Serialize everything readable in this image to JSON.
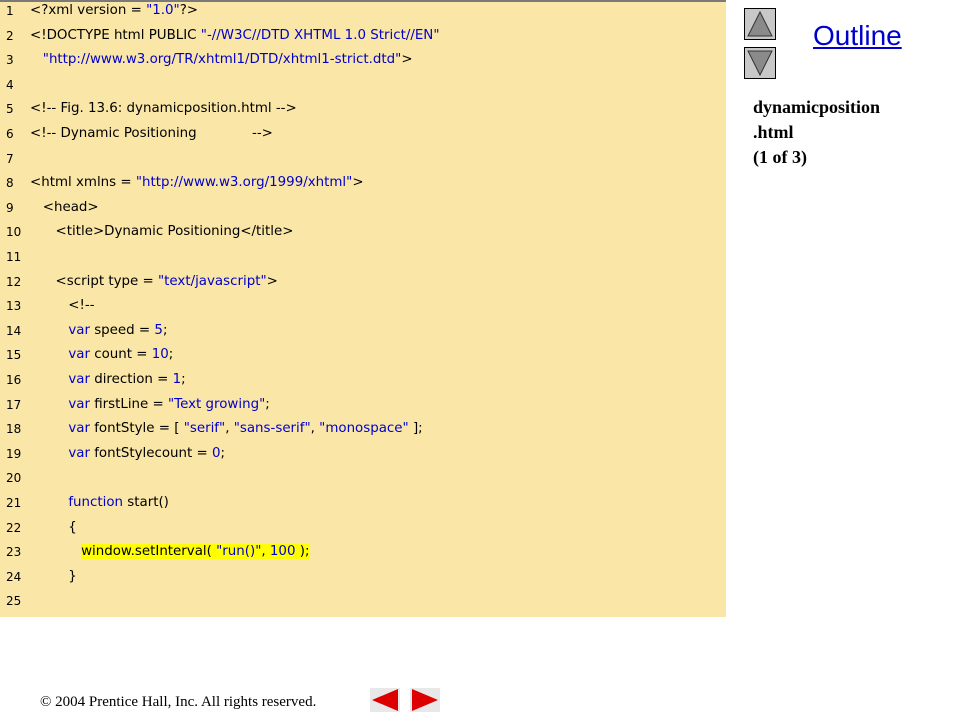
{
  "outline": {
    "title": "Outline"
  },
  "file_caption": {
    "name": "dynamicposition",
    "ext": ".html",
    "page": "(1 of 3)"
  },
  "footer": {
    "copyright": "© 2004 Prentice Hall, Inc.  All rights reserved."
  },
  "code": [
    {
      "n": "1",
      "segs": [
        [
          "t",
          "<?xml version = "
        ],
        [
          "s",
          "\"1.0\""
        ],
        [
          "t",
          "?>"
        ]
      ]
    },
    {
      "n": "2",
      "segs": [
        [
          "t",
          "<!DOCTYPE html PUBLIC "
        ],
        [
          "s",
          "\"-//W3C//DTD XHTML 1.0 Strict//EN\""
        ]
      ]
    },
    {
      "n": "3",
      "segs": [
        [
          "t",
          "   "
        ],
        [
          "s",
          "\"http://www.w3.org/TR/xhtml1/DTD/xhtml1-strict.dtd\""
        ],
        [
          "t",
          ">"
        ]
      ]
    },
    {
      "n": "4",
      "segs": []
    },
    {
      "n": "5",
      "segs": [
        [
          "t",
          "<!-- Fig. 13.6: dynamicposition.html -->"
        ]
      ]
    },
    {
      "n": "6",
      "segs": [
        [
          "t",
          "<!-- Dynamic Positioning             -->"
        ]
      ]
    },
    {
      "n": "7",
      "segs": []
    },
    {
      "n": "8",
      "segs": [
        [
          "t",
          "<html xmlns = "
        ],
        [
          "s",
          "\"http://www.w3.org/1999/xhtml\""
        ],
        [
          "t",
          ">"
        ]
      ]
    },
    {
      "n": "9",
      "segs": [
        [
          "t",
          "   <head>"
        ]
      ]
    },
    {
      "n": "10",
      "segs": [
        [
          "t",
          "      <title>"
        ],
        [
          "p",
          "Dynamic Positioning"
        ],
        [
          "t",
          "</title>"
        ]
      ]
    },
    {
      "n": "11",
      "segs": []
    },
    {
      "n": "12",
      "segs": [
        [
          "t",
          "      <script type = "
        ],
        [
          "s",
          "\"text/javascript\""
        ],
        [
          "t",
          ">"
        ]
      ]
    },
    {
      "n": "13",
      "segs": [
        [
          "t",
          "         <!--"
        ]
      ]
    },
    {
      "n": "14",
      "segs": [
        [
          "p",
          "         "
        ],
        [
          "k",
          "var"
        ],
        [
          "p",
          " speed = "
        ],
        [
          "s",
          "5"
        ],
        [
          "p",
          ";"
        ]
      ]
    },
    {
      "n": "15",
      "segs": [
        [
          "p",
          "         "
        ],
        [
          "k",
          "var"
        ],
        [
          "p",
          " count = "
        ],
        [
          "s",
          "10"
        ],
        [
          "p",
          ";"
        ]
      ]
    },
    {
      "n": "16",
      "segs": [
        [
          "p",
          "         "
        ],
        [
          "k",
          "var"
        ],
        [
          "p",
          " direction = "
        ],
        [
          "s",
          "1"
        ],
        [
          "p",
          ";"
        ]
      ]
    },
    {
      "n": "17",
      "segs": [
        [
          "p",
          "         "
        ],
        [
          "k",
          "var"
        ],
        [
          "p",
          " firstLine = "
        ],
        [
          "s",
          "\"Text growing\""
        ],
        [
          "p",
          ";"
        ]
      ]
    },
    {
      "n": "18",
      "segs": [
        [
          "p",
          "         "
        ],
        [
          "k",
          "var"
        ],
        [
          "p",
          " fontStyle = [ "
        ],
        [
          "s",
          "\"serif\""
        ],
        [
          "p",
          ", "
        ],
        [
          "s",
          "\"sans-serif\""
        ],
        [
          "p",
          ", "
        ],
        [
          "s",
          "\"monospace\""
        ],
        [
          "p",
          " ];"
        ]
      ]
    },
    {
      "n": "19",
      "segs": [
        [
          "p",
          "         "
        ],
        [
          "k",
          "var"
        ],
        [
          "p",
          " fontStylecount = "
        ],
        [
          "s",
          "0"
        ],
        [
          "p",
          ";"
        ]
      ]
    },
    {
      "n": "20",
      "segs": []
    },
    {
      "n": "21",
      "segs": [
        [
          "p",
          "         "
        ],
        [
          "k",
          "function"
        ],
        [
          "p",
          " start()"
        ]
      ]
    },
    {
      "n": "22",
      "segs": [
        [
          "p",
          "         {"
        ]
      ]
    },
    {
      "n": "23",
      "segs": [
        [
          "p",
          "            "
        ],
        [
          "h",
          "window.setInterval( "
        ],
        [
          "hs",
          "\"run()\""
        ],
        [
          "h",
          ", "
        ],
        [
          "hs",
          "100"
        ],
        [
          "h",
          " );"
        ]
      ]
    },
    {
      "n": "24",
      "segs": [
        [
          "p",
          "         }"
        ]
      ]
    },
    {
      "n": "25",
      "segs": []
    }
  ]
}
